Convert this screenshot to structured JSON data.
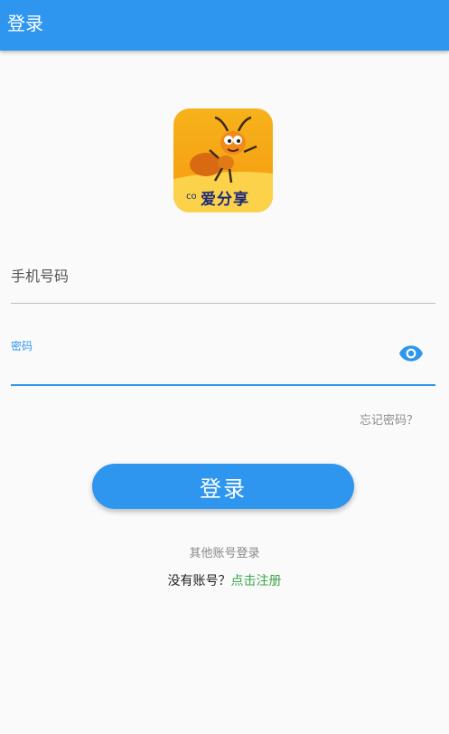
{
  "appbar": {
    "title": "登录"
  },
  "logo": {
    "text": "爱分享"
  },
  "form": {
    "phone_placeholder": "手机号码",
    "password_label": "密码",
    "forgot": "忘记密码？"
  },
  "actions": {
    "login": "登录",
    "other_login": "其他账号登录",
    "no_account": "没有账号？",
    "register": "点击注册"
  },
  "icons": {
    "visibility": "eye-icon"
  },
  "colors": {
    "primary": "#2f96f0",
    "link_green": "#3aa64a",
    "background": "#fafafa"
  }
}
